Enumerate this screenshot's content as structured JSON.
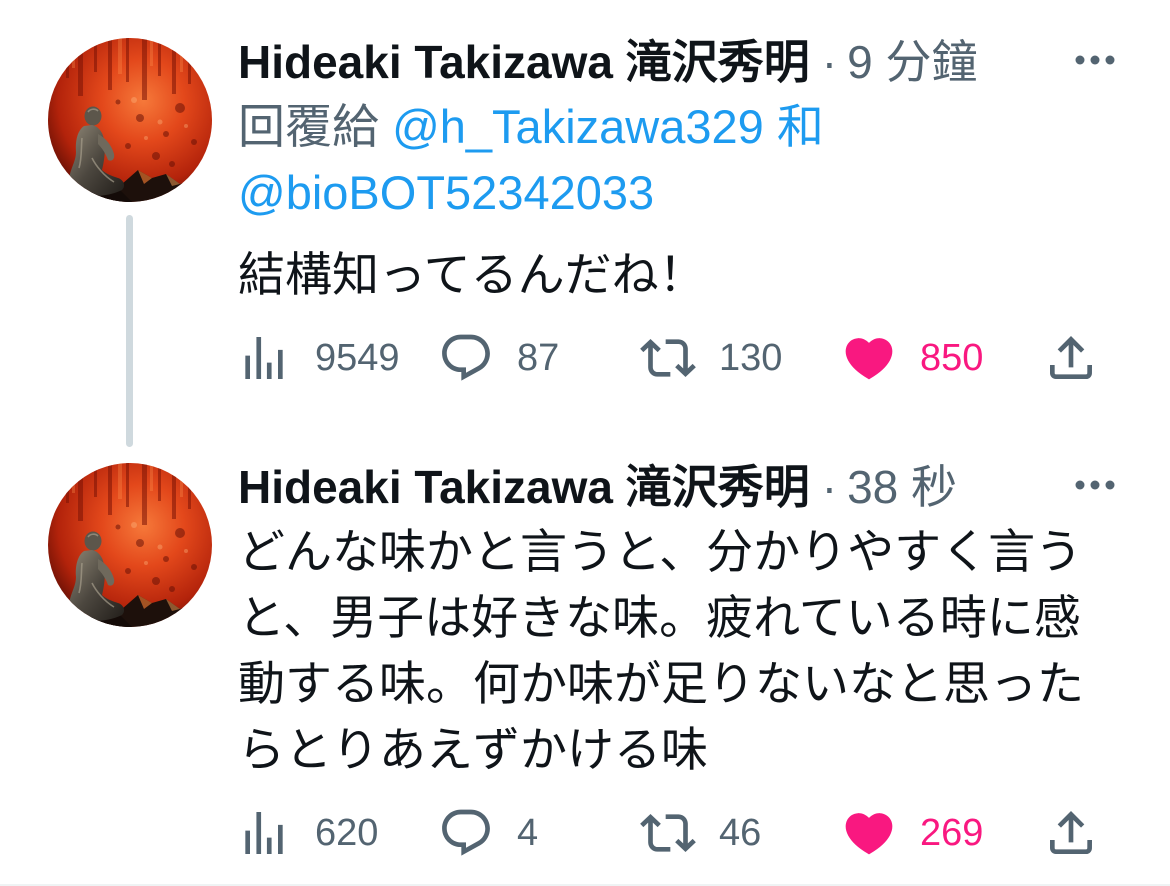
{
  "colors": {
    "text_primary": "#0f1419",
    "text_secondary": "#536471",
    "link": "#1d9bf0",
    "like": "#f91880",
    "thread_line": "#cfd9de",
    "divider": "#eff3f4",
    "background": "#ffffff"
  },
  "icons": {
    "more": "more-icon",
    "views": "views-icon",
    "reply": "reply-icon",
    "retweet": "retweet-icon",
    "like": "heart-filled-icon",
    "share": "share-icon"
  },
  "tweets": [
    {
      "author_name": "Hideaki Takizawa 滝沢秀明",
      "separator": "·",
      "time": "9 分鐘",
      "reply_to": {
        "label": "回覆給",
        "users": [
          "@h_Takizawa329",
          "@bioBOT52342033"
        ],
        "joiner": "和"
      },
      "text": "結構知ってるんだね！",
      "stats": {
        "views": "9549",
        "replies": "87",
        "retweets": "130",
        "likes": "850"
      },
      "liked": true
    },
    {
      "author_name": "Hideaki Takizawa 滝沢秀明",
      "separator": "·",
      "time": "38 秒",
      "text": "どんな味かと言うと、分かりやすく言うと、男子は好きな味。疲れている時に感動する味。何か味が足りないなと思ったらとりあえずかける味",
      "stats": {
        "views": "620",
        "replies": "4",
        "retweets": "46",
        "likes": "269"
      },
      "liked": true
    }
  ]
}
